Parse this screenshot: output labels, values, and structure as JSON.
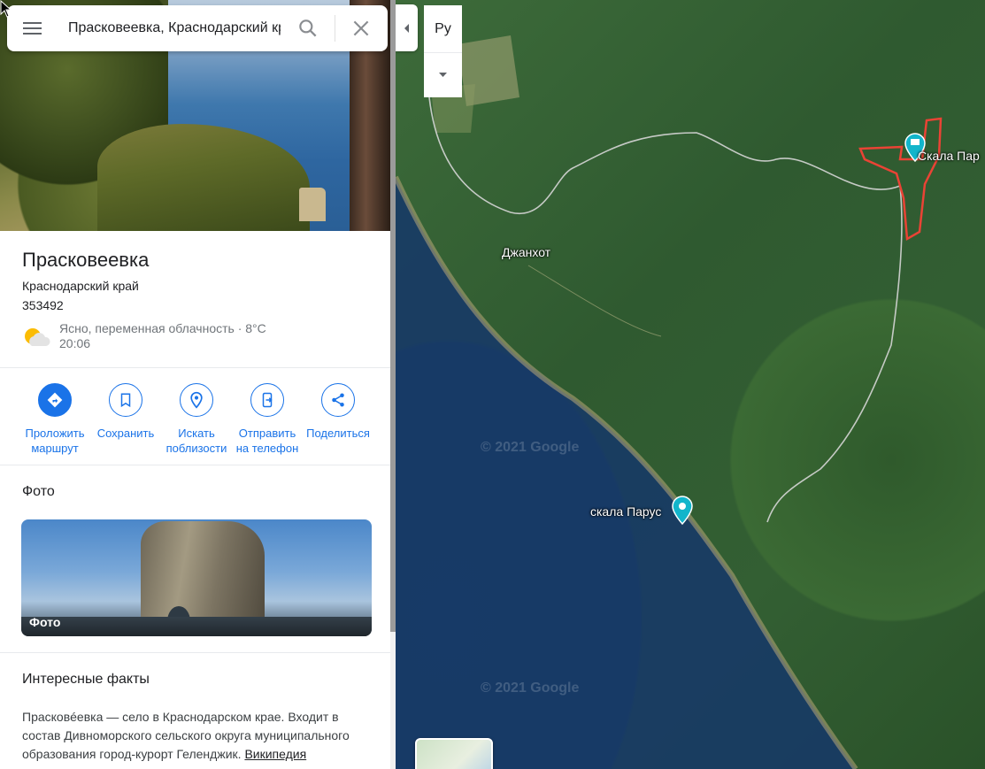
{
  "search": {
    "value": "Прасковеевка, Краснодарский край"
  },
  "place": {
    "title": "Прасковеевка",
    "region": "Краснодарский край",
    "postcode": "353492",
    "weather": {
      "line1": "Ясно, переменная облачность · 8°C",
      "line2": "20:06",
      "icon": "partly-cloudy-icon"
    }
  },
  "actions": [
    {
      "label": "Проложить маршрут",
      "icon": "directions-icon"
    },
    {
      "label": "Сохранить",
      "icon": "bookmark-icon"
    },
    {
      "label": "Искать поблизости",
      "icon": "nearby-icon"
    },
    {
      "label": "Отправить на телефон",
      "icon": "send-to-phone-icon"
    },
    {
      "label": "Поделиться",
      "icon": "share-icon"
    }
  ],
  "photos": {
    "title": "Фото",
    "card_label": "Фото"
  },
  "facts": {
    "title": "Интересные факты",
    "text": "Прасковéевка — село в Краснодарском крае. Входит в состав Дивноморского сельского округа муниципального образования город-курорт Геленджик. ",
    "link": "Википедия"
  },
  "map": {
    "lang_button": "Ру",
    "labels": {
      "village": "Джанхот",
      "poi_sail_rock": "скала Парус",
      "poi_sail_rock_2": "Скала Пар"
    },
    "watermark": "© 2021 Google",
    "colors": {
      "boundary": "#ea4335",
      "poi_teal": "#12b5cb"
    }
  }
}
